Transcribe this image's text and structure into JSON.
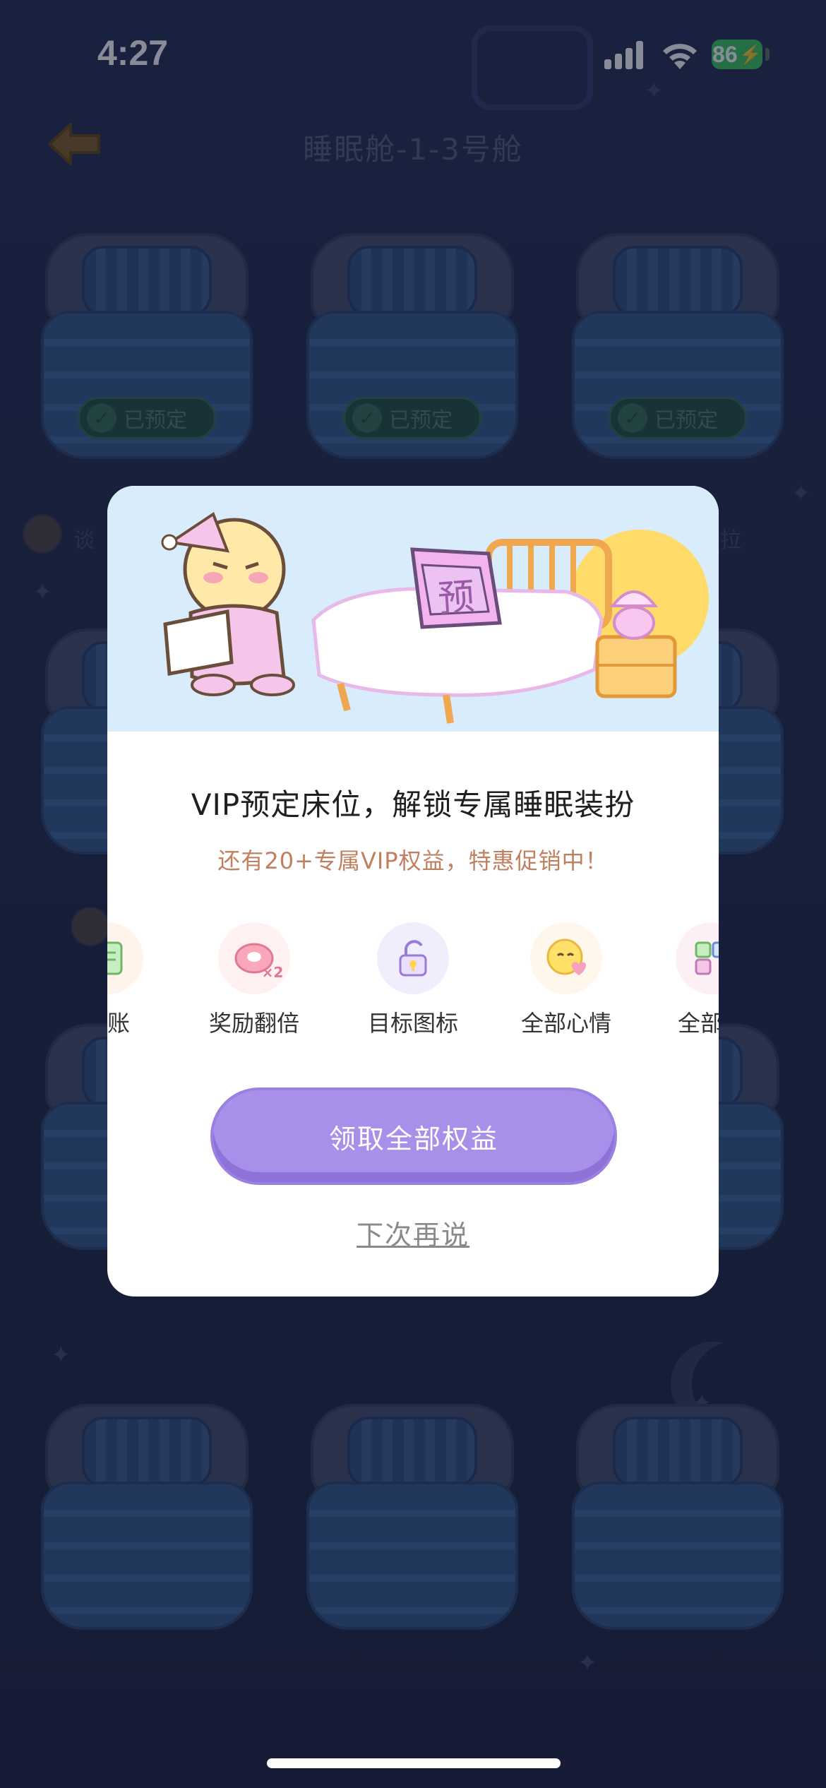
{
  "status_bar": {
    "time": "4:27",
    "battery": "86"
  },
  "header": {
    "title": "睡眠舱-1-3号舱"
  },
  "beds": {
    "reserved_label": "已预定"
  },
  "side_users": {
    "left_partial": "谈",
    "right_partial": "拉"
  },
  "dialog": {
    "banner_sign": "预",
    "title": "VIP预定床位，解锁专属睡眠装扮",
    "subtitle": "还有20+专属VIP权益，特惠促销中！",
    "benefits": [
      {
        "label": "记账",
        "icon": "ledger-icon"
      },
      {
        "label": "奖励翻倍",
        "icon": "reward-double-icon",
        "badge": "×2"
      },
      {
        "label": "目标图标",
        "icon": "goal-lock-icon"
      },
      {
        "label": "全部心情",
        "icon": "mood-face-icon"
      },
      {
        "label": "全部心",
        "icon": "widget-icon"
      }
    ],
    "claim_button": "领取全部权益",
    "later_link": "下次再说"
  },
  "colors": {
    "background": "#1c2442",
    "claim_button": "#a88fe9",
    "subtitle": "#c08060",
    "battery": "#34c759",
    "banner": "#d8ecfb"
  }
}
